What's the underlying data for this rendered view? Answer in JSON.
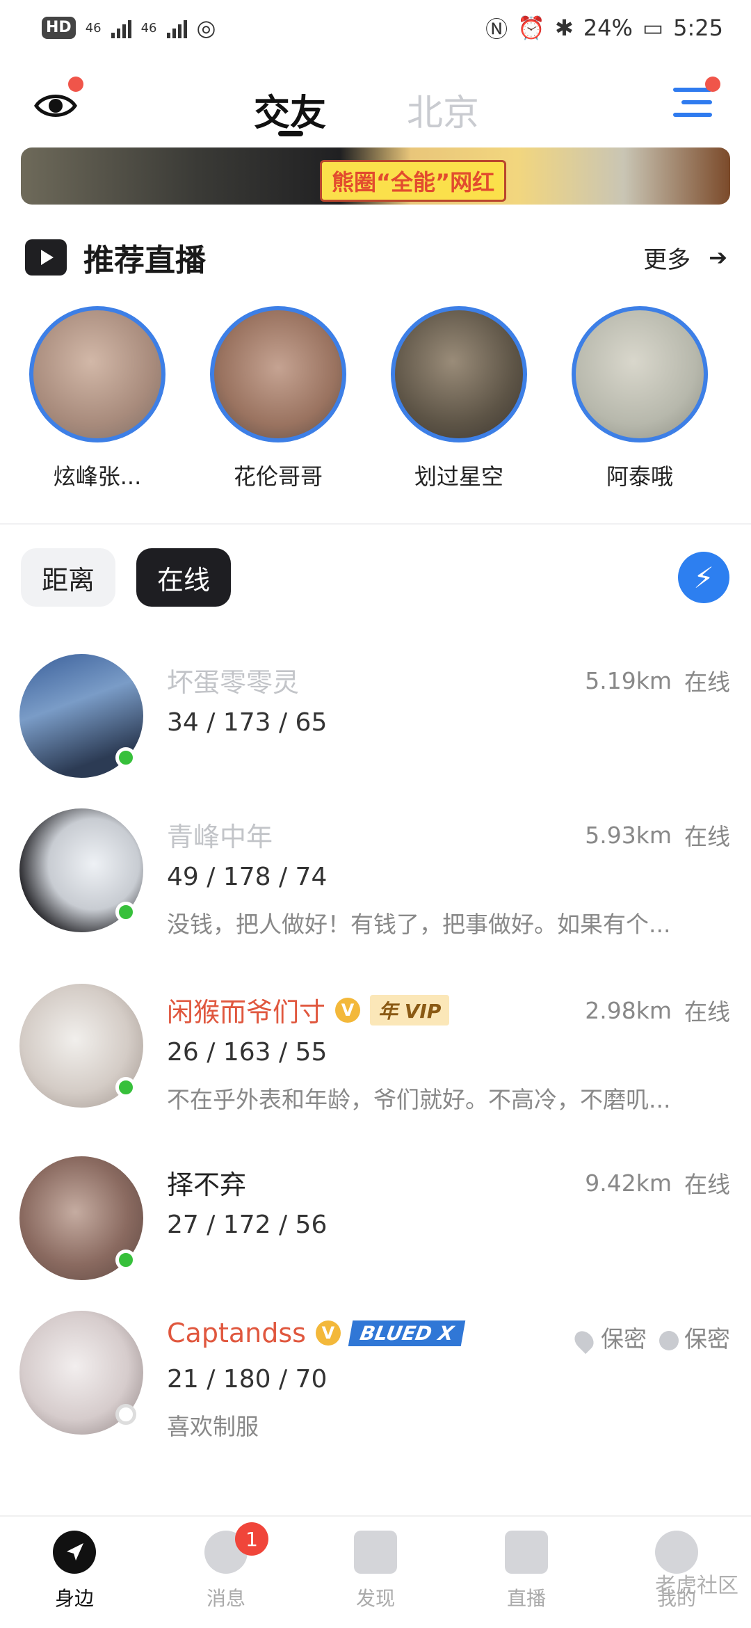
{
  "status_bar": {
    "hd": "HD",
    "network1": "46",
    "network2": "46",
    "battery": "24%",
    "time": "5:25"
  },
  "header": {
    "tab_active": "交友",
    "tab_city": "北京"
  },
  "banner": {
    "text": "熊圈“全能”网红"
  },
  "recommended": {
    "title": "推荐直播",
    "more": "更多",
    "items": [
      {
        "name": "炫峰张..."
      },
      {
        "name": "花伦哥哥"
      },
      {
        "name": "划过星空"
      },
      {
        "name": "阿泰哦"
      }
    ]
  },
  "filters": {
    "distance": "距离",
    "online": "在线"
  },
  "users": [
    {
      "name": "坏蛋零零灵",
      "stats": "34 / 173 / 65",
      "bio": "",
      "distance": "5.19km",
      "status": "在线"
    },
    {
      "name": "青峰中年",
      "stats": "49 / 178 / 74",
      "bio": "没钱，把人做好！有钱了，把事做好。如果有个...",
      "distance": "5.93km",
      "status": "在线"
    },
    {
      "name": "闲猴而爷们寸",
      "stats": "26 / 163 / 55",
      "bio": "不在乎外表和年龄，爷们就好。不高冷，不磨叽...",
      "distance": "2.98km",
      "status": "在线",
      "vip": "年 VIP"
    },
    {
      "name": "择不弃",
      "stats": "27 / 172 / 56",
      "bio": "",
      "distance": "9.42km",
      "status": "在线"
    },
    {
      "name": "Captandss",
      "stats": "21 / 180 / 70",
      "bio": "喜欢制服",
      "location": "保密",
      "time": "保密",
      "tag": "BLUED X"
    }
  ],
  "bottom_nav": {
    "nearby": "身边",
    "messages": "消息",
    "message_badge": "1",
    "discover": "发现",
    "live": "直播",
    "me": "我的"
  },
  "watermark": "老虎社区"
}
